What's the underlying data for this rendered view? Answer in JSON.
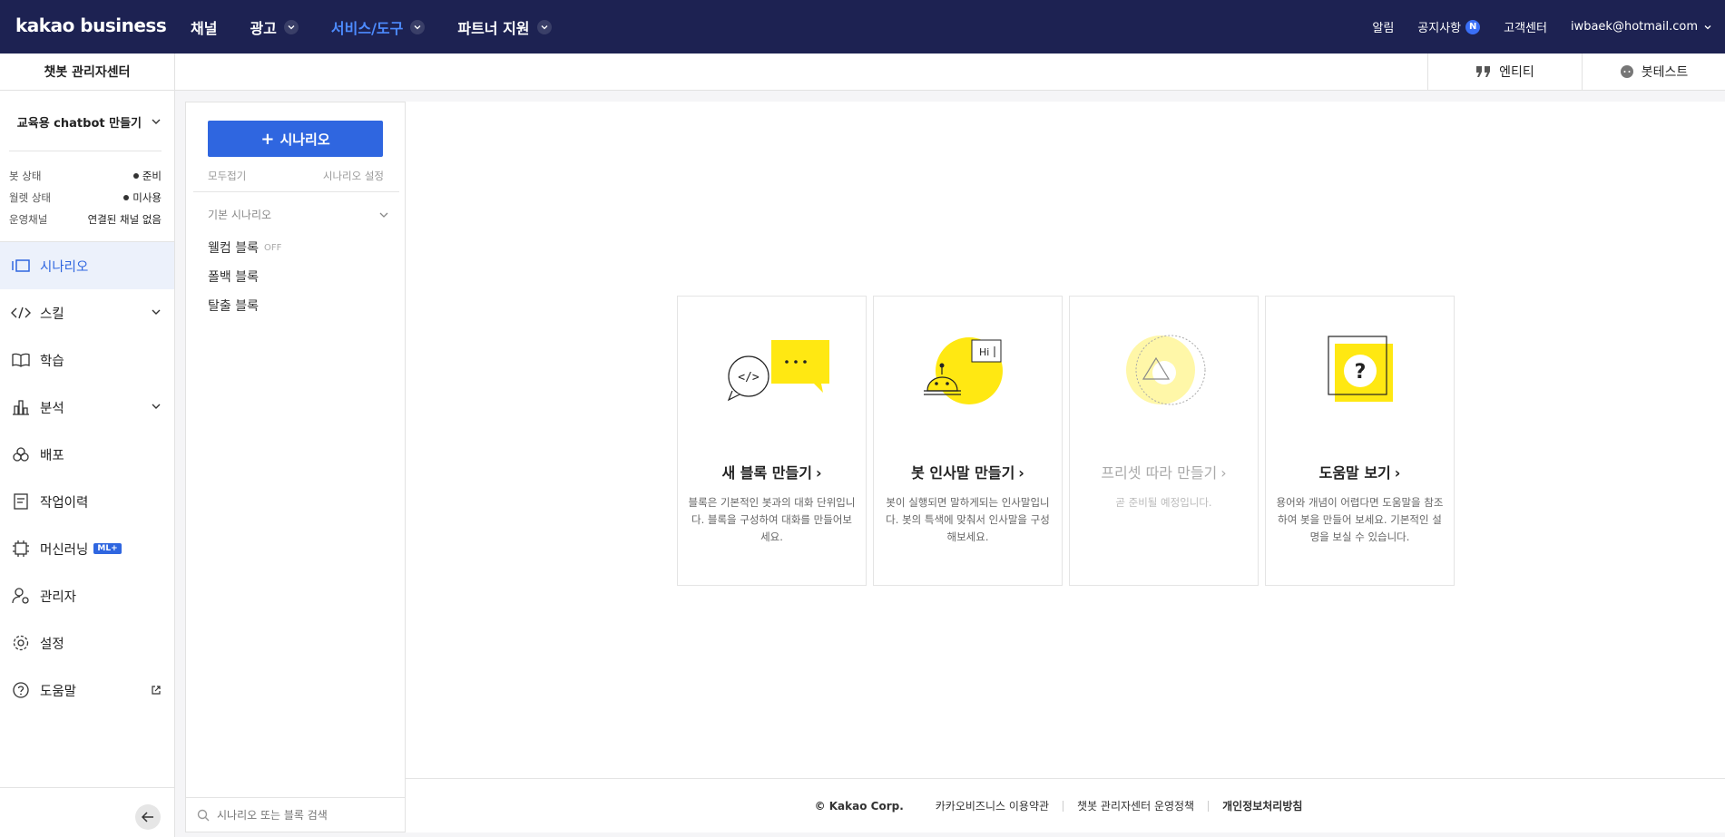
{
  "topnav": {
    "logo": "kakao business",
    "menu": [
      "채널",
      "광고",
      "서비스/도구",
      "파트너 지원"
    ],
    "right": {
      "alarm": "알림",
      "notice": "공지사항",
      "notice_badge": "N",
      "support": "고객센터",
      "account": "iwbaek@hotmail.com"
    }
  },
  "subbar": {
    "title": "챗봇 관리자센터",
    "entity": "엔티티",
    "bot_test": "봇테스트"
  },
  "sidebar": {
    "bot_name": "교육용 chatbot 만들기",
    "status": [
      {
        "label": "봇 상태",
        "value": "준비"
      },
      {
        "label": "월렛 상태",
        "value": "미사용"
      },
      {
        "label": "운영채널",
        "value": "연결된 채널 없음"
      }
    ],
    "menu": [
      "시나리오",
      "스킬",
      "학습",
      "분석",
      "배포",
      "작업이력",
      "머신러닝",
      "관리자",
      "설정",
      "도움말"
    ],
    "ml_badge": "ML+"
  },
  "scenario": {
    "add_label": "시나리오",
    "collapse_all": "모두접기",
    "settings": "시나리오 설정",
    "group": "기본 시나리오",
    "blocks": [
      {
        "name": "웰컴 블록",
        "tag": "OFF"
      },
      {
        "name": "폴백 블록",
        "tag": ""
      },
      {
        "name": "탈출 블록",
        "tag": ""
      }
    ],
    "search_placeholder": "시나리오 또는 블록 검색"
  },
  "cards": [
    {
      "title": "새 블록 만들기",
      "desc": "블록은 기본적인 봇과의 대화 단위입니다. 블록을 구성하여 대화를 만들어보세요."
    },
    {
      "title": "봇 인사말 만들기",
      "desc": "봇이 실행되면 말하게되는 인사말입니다. 봇의 특색에 맞춰서 인사말을 구성해보세요.",
      "hi": "Hi"
    },
    {
      "title": "프리셋 따라 만들기",
      "desc": "곧 준비될 예정입니다."
    },
    {
      "title": "도움말 보기",
      "desc": "용어와 개념이 어렵다면 도움말을 참조하여 봇을 만들어 보세요. 기본적인 설명을 보실 수 있습니다.",
      "mark": "?"
    }
  ],
  "footer": {
    "copyright": "© Kakao Corp.",
    "terms": "카카오비즈니스 이용약관",
    "policy": "챗봇 관리자센터 운영정책",
    "privacy": "개인정보처리방침"
  },
  "colors": {
    "nav_bg": "#1d2252",
    "accent": "#2f66e0",
    "yellow": "#ffe812"
  }
}
